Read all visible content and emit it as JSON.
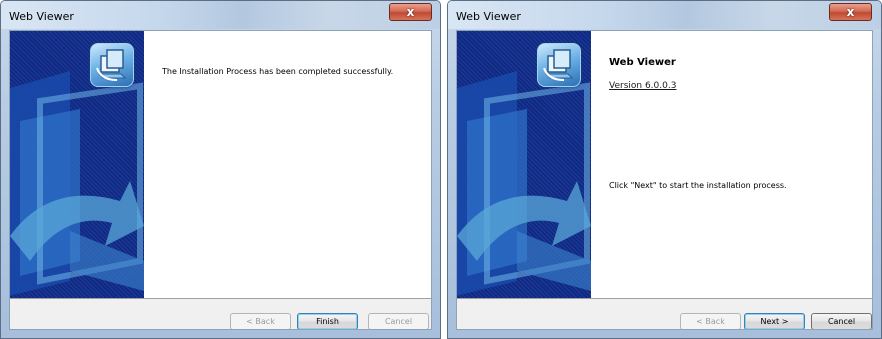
{
  "windows": [
    {
      "title": "Web Viewer",
      "close_label": "x",
      "message": "The Installation Process has been completed successfully.",
      "buttons": {
        "back": "< Back",
        "primary": "Finish",
        "cancel": "Cancel"
      }
    },
    {
      "title": "Web Viewer",
      "close_label": "x",
      "product_name": "Web Viewer",
      "version": "Version 6.0.0.3",
      "message": "Click \"Next\" to start the installation process.",
      "buttons": {
        "back": "< Back",
        "primary": "Next >",
        "cancel": "Cancel"
      }
    }
  ],
  "colors": {
    "banner_blue": "#0e2a86",
    "banner_accent": "#5aa8d8",
    "close_red": "#c04a33"
  },
  "icons": [
    "installer-logo-icon",
    "close-icon"
  ]
}
